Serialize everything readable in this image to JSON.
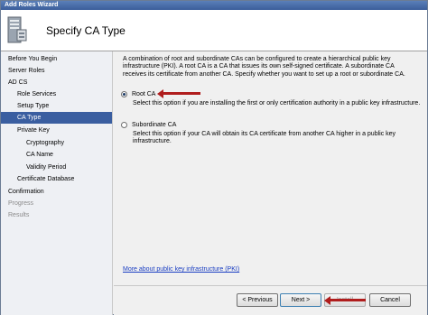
{
  "window": {
    "title": "Add Roles Wizard"
  },
  "header": {
    "page_title": "Specify CA Type",
    "icon": "server-roles-icon"
  },
  "nav": {
    "items": [
      {
        "label": "Before You Begin",
        "state": "normal"
      },
      {
        "label": "Server Roles",
        "state": "normal"
      },
      {
        "label": "AD CS",
        "state": "normal"
      },
      {
        "label": "Role Services",
        "state": "normal"
      },
      {
        "label": "Setup Type",
        "state": "normal"
      },
      {
        "label": "CA Type",
        "state": "active"
      },
      {
        "label": "Private Key",
        "state": "normal"
      },
      {
        "label": "Cryptography",
        "state": "normal"
      },
      {
        "label": "CA Name",
        "state": "normal"
      },
      {
        "label": "Validity Period",
        "state": "normal"
      },
      {
        "label": "Certificate Database",
        "state": "normal"
      },
      {
        "label": "Confirmation",
        "state": "normal"
      },
      {
        "label": "Progress",
        "state": "disabled"
      },
      {
        "label": "Results",
        "state": "disabled"
      }
    ]
  },
  "content": {
    "description": "A combination of root and subordinate CAs can be configured to create a hierarchical public key infrastructure (PKI). A root CA is a CA that issues its own self-signed certificate. A subordinate CA receives its certificate from another CA. Specify whether you want to set up a root or subordinate CA.",
    "options": [
      {
        "label": "Root CA",
        "checked": true,
        "description": "Select this option if you are installing the first or only certification authority in a public key infrastructure."
      },
      {
        "label": "Subordinate CA",
        "checked": false,
        "description": "Select this option if your CA will obtain its CA certificate from another CA higher in a public key infrastructure."
      }
    ],
    "link": "More about public key infrastructure (PKI)"
  },
  "footer": {
    "previous_label": "< Previous",
    "next_label": "Next >",
    "install_label": "Install",
    "cancel_label": "Cancel"
  },
  "colors": {
    "title_bar": "#3b5e9a",
    "nav_active": "#3a5ea0",
    "annotation_arrow": "#b01d1d",
    "link": "#1a3ec2"
  }
}
